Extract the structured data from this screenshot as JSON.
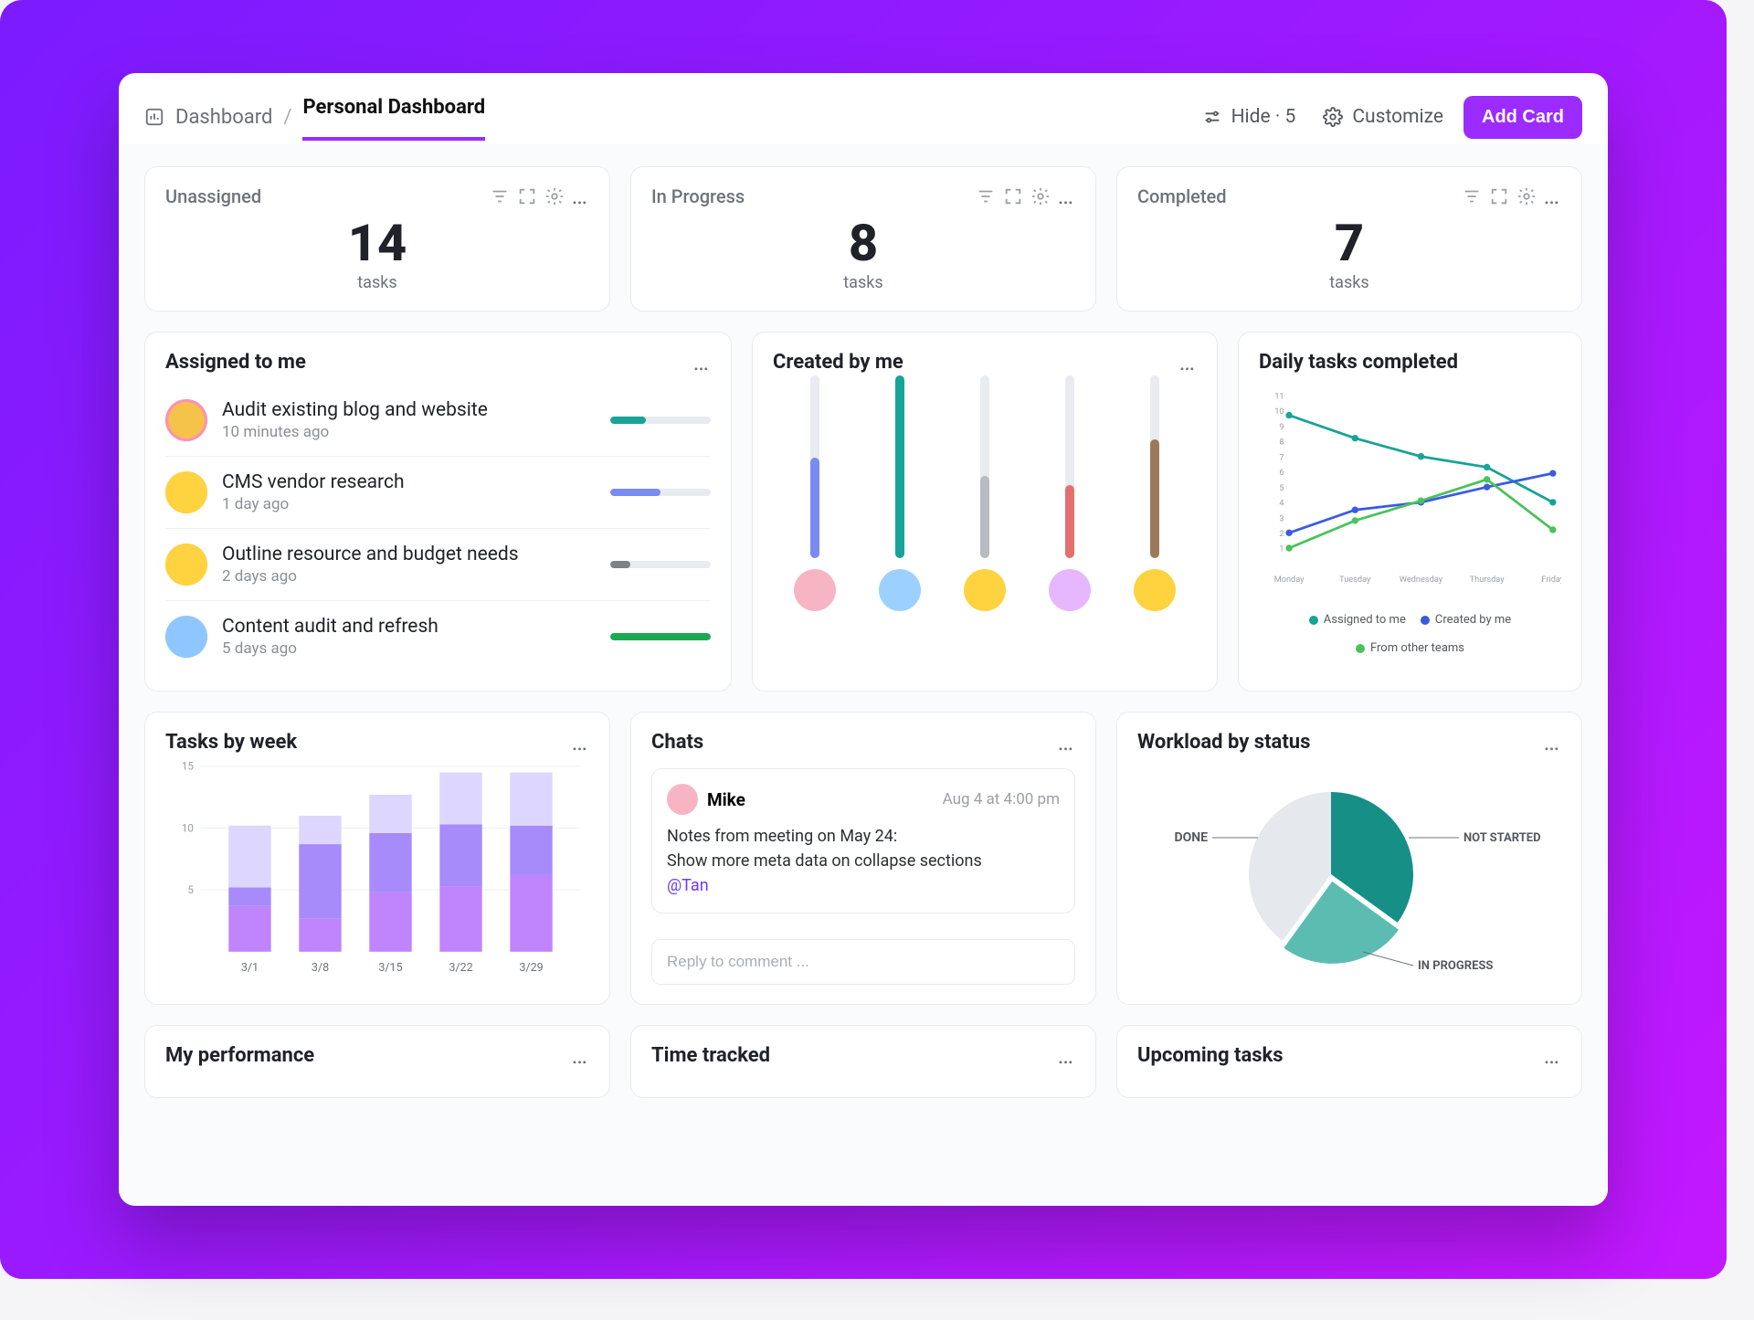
{
  "breadcrumb": {
    "root": "Dashboard",
    "current": "Personal Dashboard"
  },
  "toolbar": {
    "hide_label": "Hide · 5",
    "customize_label": "Customize",
    "add_card_label": "Add Card"
  },
  "stats": [
    {
      "title": "Unassigned",
      "value": "14",
      "unit": "tasks"
    },
    {
      "title": "In Progress",
      "value": "8",
      "unit": "tasks"
    },
    {
      "title": "Completed",
      "value": "7",
      "unit": "tasks"
    }
  ],
  "assigned": {
    "title": "Assigned to me",
    "items": [
      {
        "title": "Audit existing blog and website",
        "time": "10 minutes ago",
        "avatar_bg": "#f6c34a",
        "avatar_ring": "#ff8fb8",
        "progress": 35,
        "color": "#17a398"
      },
      {
        "title": " CMS vendor research",
        "time": "1 day ago",
        "avatar_bg": "#ffd23f",
        "avatar_ring": "#ffd23f",
        "progress": 50,
        "color": "#7a8bf0"
      },
      {
        "title": "Outline resource and budget needs",
        "time": "2 days ago",
        "avatar_bg": "#ffd23f",
        "avatar_ring": "#ffd23f",
        "progress": 20,
        "color": "#7e8185"
      },
      {
        "title": "Content audit and refresh",
        "time": "5 days ago",
        "avatar_bg": "#8ec7ff",
        "avatar_ring": "#8ec7ff",
        "progress": 100,
        "color": "#1aa951"
      }
    ]
  },
  "created": {
    "title": "Created by me",
    "bars": [
      {
        "value": 55,
        "color": "#7a8bf0",
        "avatar": "#f7b5c3"
      },
      {
        "value": 100,
        "color": "#17a398",
        "avatar": "#9cd0ff"
      },
      {
        "value": 45,
        "color": "#b7bcc3",
        "avatar": "#ffd23f"
      },
      {
        "value": 40,
        "color": "#e27070",
        "avatar": "#e6b7ff"
      },
      {
        "value": 65,
        "color": "#9a7a58",
        "avatar": "#ffd23f"
      }
    ]
  },
  "daily": {
    "title": "Daily tasks completed",
    "legend": [
      {
        "label": "Assigned to me",
        "color": "#17a398"
      },
      {
        "label": "Created by me",
        "color": "#3a5be0"
      },
      {
        "label": "From other teams",
        "color": "#49c35a"
      }
    ]
  },
  "weekly": {
    "title": "Tasks by week"
  },
  "chats": {
    "title": "Chats",
    "message": {
      "author": "Mike",
      "time": "Aug 4 at 4:00 pm",
      "line1": "Notes from meeting on May 24:",
      "line2": "Show more meta data on collapse sections",
      "mention": "@Tan"
    },
    "reply_placeholder": "Reply to comment ..."
  },
  "workload": {
    "title": "Workload by status",
    "labels": {
      "done": "DONE",
      "not_started": "NOT STARTED",
      "in_progress": "IN PROGRESS"
    }
  },
  "mini_cards": {
    "perf": "My performance",
    "time": "Time tracked",
    "upcoming": "Upcoming tasks"
  },
  "chart_data": [
    {
      "type": "line",
      "title": "Daily tasks completed",
      "categories": [
        "Monday",
        "Tuesday",
        "Wednesday",
        "Thursday",
        "Friday"
      ],
      "ylim": [
        0,
        11
      ],
      "series": [
        {
          "name": "Assigned to me",
          "values": [
            9.7,
            8.2,
            7.0,
            6.3,
            4.0
          ],
          "color": "#17a398"
        },
        {
          "name": "Created by me",
          "values": [
            2.0,
            3.5,
            4.0,
            5.0,
            5.9
          ],
          "color": "#3a5be0"
        },
        {
          "name": "From other teams",
          "values": [
            1.0,
            2.8,
            4.1,
            5.5,
            2.2
          ],
          "color": "#49c35a"
        }
      ]
    },
    {
      "type": "bar",
      "title": "Tasks by week",
      "categories": [
        "3/1",
        "3/8",
        "3/15",
        "3/22",
        "3/29"
      ],
      "ylim": [
        0,
        15
      ],
      "stacked": true,
      "series": [
        {
          "name": "low",
          "values": [
            3.7,
            2.7,
            4.8,
            5.3,
            6.2
          ],
          "color": "#c084fc"
        },
        {
          "name": "mid",
          "values": [
            1.5,
            6.0,
            4.8,
            5.0,
            4.0
          ],
          "color": "#a78bfa"
        },
        {
          "name": "top",
          "values": [
            5.0,
            2.3,
            3.1,
            4.2,
            4.3
          ],
          "color": "#ddd6fe"
        }
      ]
    },
    {
      "type": "pie",
      "title": "Workload by status",
      "slices": [
        {
          "label": "DONE",
          "value": 35,
          "color": "#168f87"
        },
        {
          "label": "IN PROGRESS",
          "value": 25,
          "color": "#5bbdb2"
        },
        {
          "label": "NOT STARTED",
          "value": 40,
          "color": "#e5e8ec"
        }
      ]
    }
  ]
}
